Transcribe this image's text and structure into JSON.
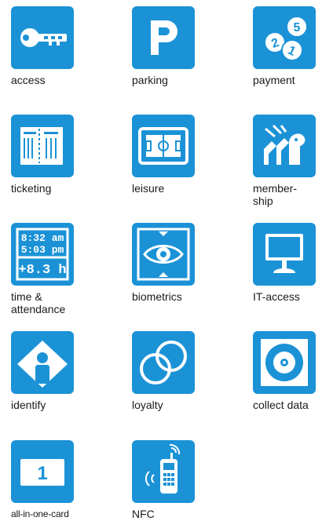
{
  "colors": {
    "accent": "#1b92d6",
    "icon_fg": "#ffffff",
    "text": "#1a1a1a"
  },
  "tiles": [
    {
      "label": "access",
      "icon": "key-icon"
    },
    {
      "label": "parking",
      "icon": "parking-icon"
    },
    {
      "label": "payment",
      "icon": "coins-icon"
    },
    {
      "label": "ticketing",
      "icon": "tickets-icon"
    },
    {
      "label": "leisure",
      "icon": "football-field-icon"
    },
    {
      "label": "member-\nship",
      "icon": "members-icon"
    },
    {
      "label": "time &\nattendance",
      "icon": "time-clock-icon",
      "time_in": "8:32 am",
      "time_out": "5:03 pm",
      "total": "+8.3 h"
    },
    {
      "label": "biometrics",
      "icon": "eye-icon"
    },
    {
      "label": "IT-access",
      "icon": "monitor-icon"
    },
    {
      "label": "identify",
      "icon": "person-card-icon"
    },
    {
      "label": "loyalty",
      "icon": "interlocked-rings-icon"
    },
    {
      "label": "collect data",
      "icon": "disc-icon"
    },
    {
      "label": "all-in-one-card",
      "icon": "card-one-icon",
      "card_number": "1"
    },
    {
      "label": "NFC",
      "icon": "nfc-phone-icon"
    }
  ]
}
